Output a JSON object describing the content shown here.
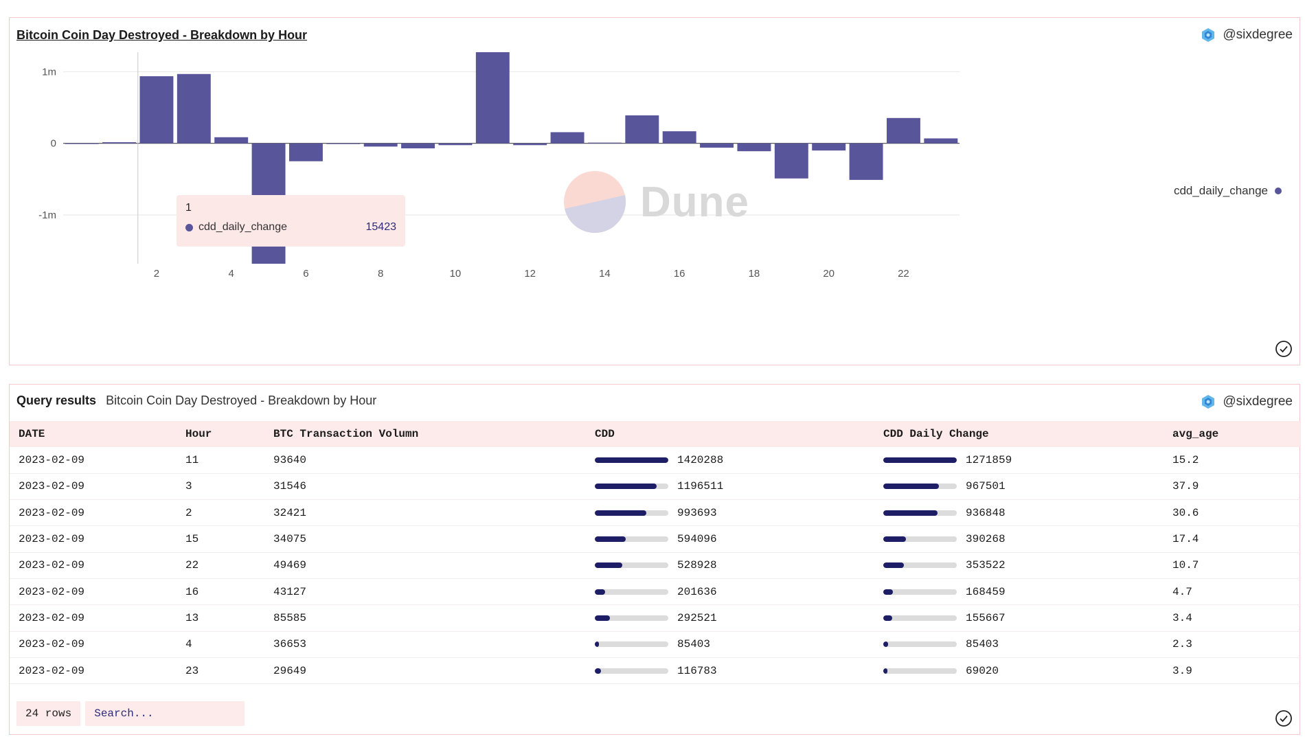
{
  "chart_panel": {
    "title": "Bitcoin Coin Day Destroyed - Breakdown by Hour",
    "author": "@sixdegree",
    "legend_label": "cdd_daily_change",
    "tooltip": {
      "title": "1",
      "series": "cdd_daily_change",
      "value": "15423"
    },
    "watermark": "Dune"
  },
  "chart_data": {
    "type": "bar",
    "series": [
      {
        "name": "cdd_daily_change",
        "x": [
          0,
          1,
          2,
          3,
          4,
          5,
          6,
          7,
          8,
          9,
          10,
          11,
          12,
          13,
          14,
          15,
          16,
          17,
          18,
          19,
          20,
          21,
          22,
          23
        ],
        "values": [
          0,
          15423,
          936848,
          967501,
          85403,
          -1680000,
          -250000,
          -10000,
          -45000,
          -70000,
          -25000,
          1271859,
          -25000,
          155667,
          10000,
          390268,
          168459,
          -60000,
          -110000,
          -490000,
          -100000,
          -510000,
          353522,
          69020
        ]
      }
    ],
    "xticks": [
      2,
      4,
      6,
      8,
      10,
      12,
      14,
      16,
      18,
      20,
      22
    ],
    "yticks": [
      {
        "value": 1000000,
        "label": "1m"
      },
      {
        "value": 0,
        "label": "0"
      },
      {
        "value": -1000000,
        "label": "-1m"
      }
    ],
    "ylim": [
      -1680000,
      1271859
    ],
    "xlim": [
      -0.5,
      23.5
    ],
    "highlight_x": 1,
    "color": "#58559a"
  },
  "table_panel": {
    "label": "Query results",
    "title": "Bitcoin Coin Day Destroyed - Breakdown by Hour",
    "author": "@sixdegree",
    "columns": [
      "DATE",
      "Hour",
      "BTC Transaction Volumn",
      "CDD",
      "CDD Daily Change",
      "avg_age"
    ],
    "rows": [
      {
        "date": "2023-02-09",
        "hour": "11",
        "volume": "93640",
        "cdd": "1420288",
        "cdd_frac": 1.0,
        "change": "1271859",
        "change_frac": 1.0,
        "avg_age": "15.2"
      },
      {
        "date": "2023-02-09",
        "hour": "3",
        "volume": "31546",
        "cdd": "1196511",
        "cdd_frac": 0.842,
        "change": "967501",
        "change_frac": 0.761,
        "avg_age": "37.9"
      },
      {
        "date": "2023-02-09",
        "hour": "2",
        "volume": "32421",
        "cdd": "993693",
        "cdd_frac": 0.7,
        "change": "936848",
        "change_frac": 0.737,
        "avg_age": "30.6"
      },
      {
        "date": "2023-02-09",
        "hour": "15",
        "volume": "34075",
        "cdd": "594096",
        "cdd_frac": 0.418,
        "change": "390268",
        "change_frac": 0.307,
        "avg_age": "17.4"
      },
      {
        "date": "2023-02-09",
        "hour": "22",
        "volume": "49469",
        "cdd": "528928",
        "cdd_frac": 0.372,
        "change": "353522",
        "change_frac": 0.278,
        "avg_age": "10.7"
      },
      {
        "date": "2023-02-09",
        "hour": "16",
        "volume": "43127",
        "cdd": "201636",
        "cdd_frac": 0.142,
        "change": "168459",
        "change_frac": 0.132,
        "avg_age": "4.7"
      },
      {
        "date": "2023-02-09",
        "hour": "13",
        "volume": "85585",
        "cdd": "292521",
        "cdd_frac": 0.206,
        "change": "155667",
        "change_frac": 0.122,
        "avg_age": "3.4"
      },
      {
        "date": "2023-02-09",
        "hour": "4",
        "volume": "36653",
        "cdd": "85403",
        "cdd_frac": 0.06,
        "change": "85403",
        "change_frac": 0.067,
        "avg_age": "2.3"
      },
      {
        "date": "2023-02-09",
        "hour": "23",
        "volume": "29649",
        "cdd": "116783",
        "cdd_frac": 0.082,
        "change": "69020",
        "change_frac": 0.054,
        "avg_age": "3.9"
      }
    ],
    "row_count": "24 rows",
    "search_placeholder": "Search..."
  }
}
